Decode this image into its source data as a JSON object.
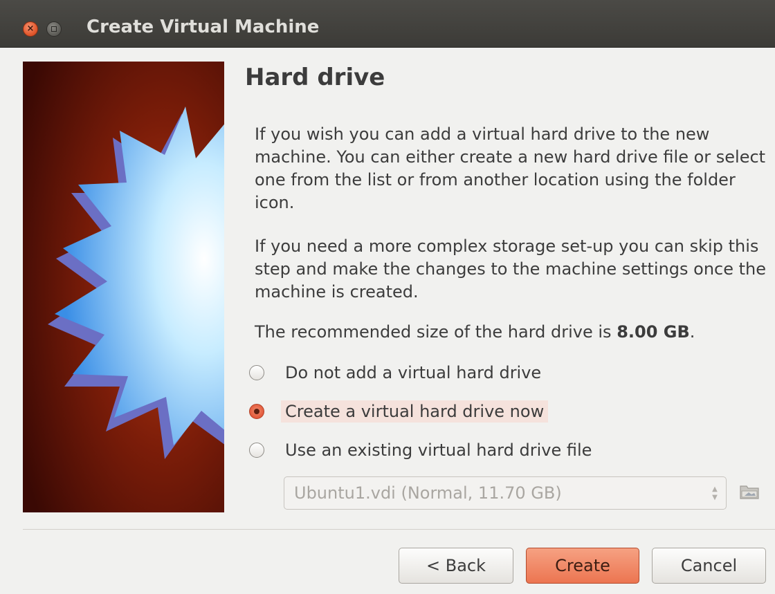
{
  "window": {
    "title": "Create Virtual Machine"
  },
  "page": {
    "heading": "Hard drive",
    "paragraph1": "If you wish you can add a virtual hard drive to the new machine. You can either create a new hard drive file or select one from the list or from another location using the folder icon.",
    "paragraph2": "If you need a more complex storage set-up you can skip this step and make the changes to the machine settings once the machine is created.",
    "recommended_prefix": "The recommended size of the hard drive is ",
    "recommended_size": "8.00 GB",
    "recommended_suffix": "."
  },
  "options": [
    {
      "label": "Do not add a virtual hard drive",
      "checked": false
    },
    {
      "label": "Create a virtual hard drive now",
      "checked": true
    },
    {
      "label": "Use an existing virtual hard drive file",
      "checked": false
    }
  ],
  "existing_file": {
    "selected": "Ubuntu1.vdi (Normal, 11.70 GB)",
    "enabled": false
  },
  "buttons": {
    "back": "< Back",
    "create": "Create",
    "cancel": "Cancel"
  },
  "colors": {
    "accent": "#ec7551",
    "banner": "#7a1a0a",
    "titlebar": "#3c3b37"
  },
  "icons": {
    "close": "close-icon",
    "minimize": "minimize-icon",
    "folder": "folder-icon",
    "banner": "virtualbox-starburst-icon"
  }
}
